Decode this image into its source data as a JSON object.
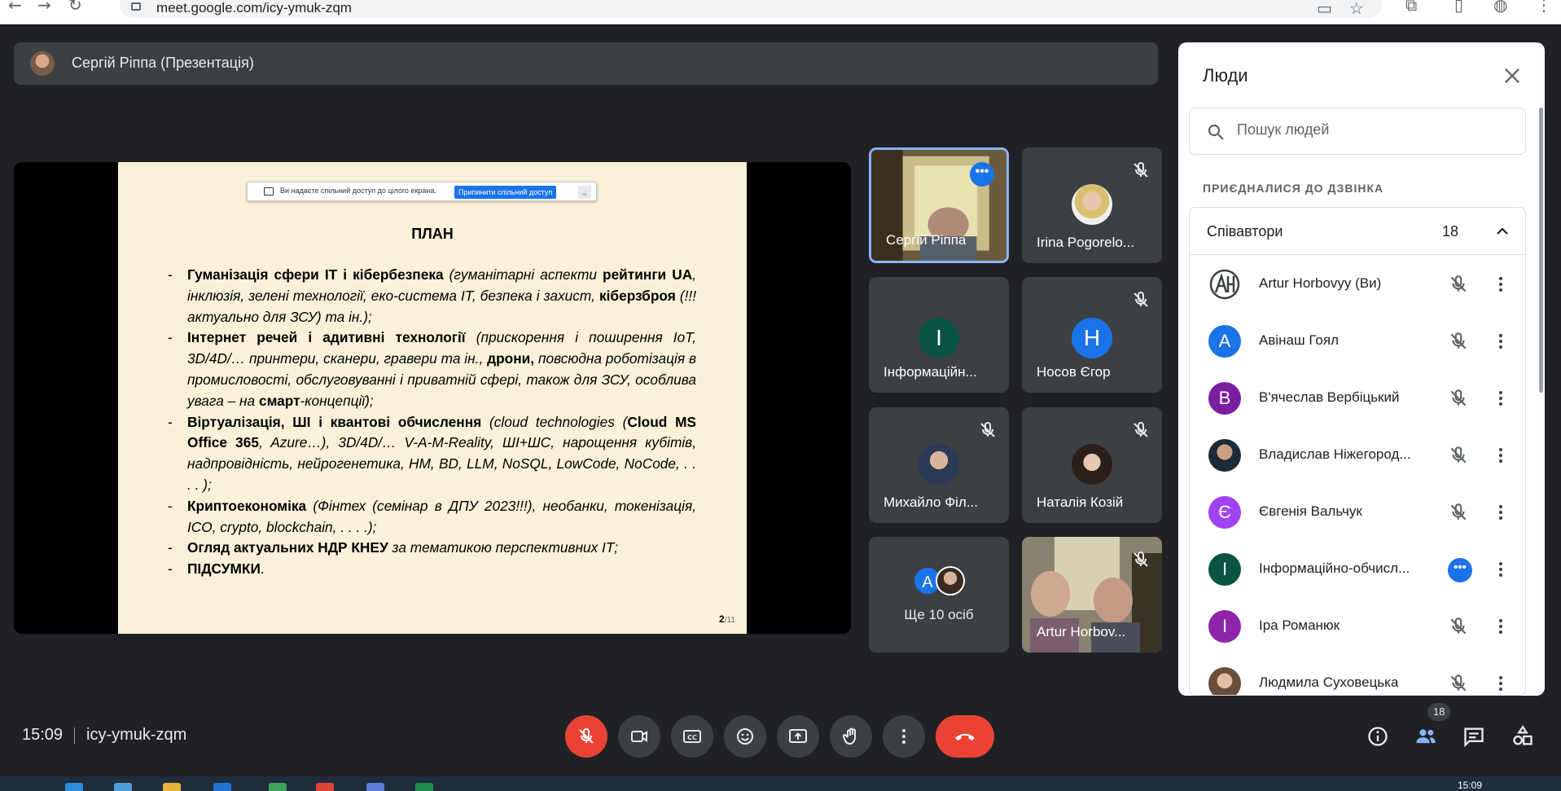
{
  "browser": {
    "url": "meet.google.com/icy-ymuk-zqm"
  },
  "presenter": {
    "name": "Сергій Ріппа (Презентація)"
  },
  "share_banner": {
    "text": "Ви надаєте спільний доступ до цілого екрана.",
    "stop_label": "Припинити спільний доступ",
    "hide_label": "_"
  },
  "slide": {
    "title": "ПЛАН",
    "page_current": "2",
    "page_total": "/11",
    "items": [
      {
        "bold1": "Гуманізація сфери ІТ і кібербезпека",
        "text1": " (гуманітарні аспекти ",
        "bold2": "рейтинги UA",
        "text2": ", інклюзія, зелені технології, еко-система ІТ, безпека і захист, ",
        "bold3": "кіберзброя",
        "text3": " (!!! актуально для ЗСУ) та ін.);"
      },
      {
        "bold1": "Інтернет речей і адитивні технології",
        "text1": " (прискорення і поширення IoT, 3D/4D/… принтери, сканери, гравери та ін., ",
        "bold2": "дрони,",
        "text2": " повсюдна роботізація в промисловості, обслуговуванні і приватній сфері, також для ЗСУ, особлива увага – на ",
        "bold3": "смарт",
        "text3": "-концепції);"
      },
      {
        "bold1": "Віртуалізація, ШІ і квантові обчислення",
        "text1": " (cloud technologies (",
        "bold2": "Cloud MS Office 365",
        "text2": ", Azure…), 3D/4D/… V-A-M-Reality, ШІ+ШС, нарощення кубітів, надпровідність, нейрогенетика, НМ, BD, LLM, NoSQL, LowCode, NoCode, . . . . );",
        "bold3": "",
        "text3": ""
      },
      {
        "bold1": "Криптоекономіка",
        "text1": " (Фінтех (семінар в ДПУ 2023!!!), необанки, токенізація, ICO, crypto, blockchain, . . . .);",
        "bold2": "",
        "text2": "",
        "bold3": "",
        "text3": ""
      },
      {
        "bold1": "Огляд актуальних НДР КНЕУ",
        "text1": " за тематикою перспективних ІТ;",
        "bold2": "",
        "text2": "",
        "bold3": "",
        "text3": ""
      },
      {
        "bold1": "ПІДСУМКИ",
        "text1": ".",
        "bold2": "",
        "text2": "",
        "bold3": "",
        "text3": ""
      }
    ]
  },
  "tiles": {
    "t1": {
      "name": "Сергій Ріппа"
    },
    "t2": {
      "name": "Irina Pogorelo..."
    },
    "t3": {
      "name": "Інформаційн...",
      "letter": "І",
      "color": "#0b5345"
    },
    "t4": {
      "name": "Носов Єгор",
      "letter": "Н",
      "color": "#1a73e8"
    },
    "t5": {
      "name": "Михайло Філ..."
    },
    "t6": {
      "name": "Наталія Козій"
    },
    "t7": {
      "label": "Ще 10 осіб",
      "letter": "А"
    },
    "t8": {
      "name": "Artur Horbov..."
    }
  },
  "people": {
    "title": "Люди",
    "search_placeholder": "Пошук людей",
    "section": "ПРИЄДНАЛИСЯ ДО ДЗВІНКА",
    "group_label": "Співавтори",
    "group_count": "18",
    "list": [
      {
        "name": "Artur Horbovyy (Ви)",
        "letter": "",
        "color": "#ffffff",
        "muted": true
      },
      {
        "name": "Авінаш Гоял",
        "letter": "А",
        "color": "#1a73e8",
        "muted": true
      },
      {
        "name": "В'ячеслав Вербіцький",
        "letter": "В",
        "color": "#7b1fa2",
        "muted": true
      },
      {
        "name": "Владислав Ніжегород...",
        "letter": "",
        "color": "#5d4a3a",
        "muted": true
      },
      {
        "name": "Євгенія Вальчук",
        "letter": "Є",
        "color": "#a142f4",
        "muted": true
      },
      {
        "name": "Інформаційно-обчисл...",
        "letter": "І",
        "color": "#0b5345",
        "muted": false
      },
      {
        "name": "Іра Романюк",
        "letter": "І",
        "color": "#8e24aa",
        "muted": true
      },
      {
        "name": "Людмила Суховецька",
        "letter": "",
        "color": "#b98a6e",
        "muted": true
      }
    ]
  },
  "bottom": {
    "time": "15:09",
    "meeting_code": "icy-ymuk-zqm",
    "people_badge": "18"
  },
  "taskbar": {
    "clock": "15:09"
  }
}
